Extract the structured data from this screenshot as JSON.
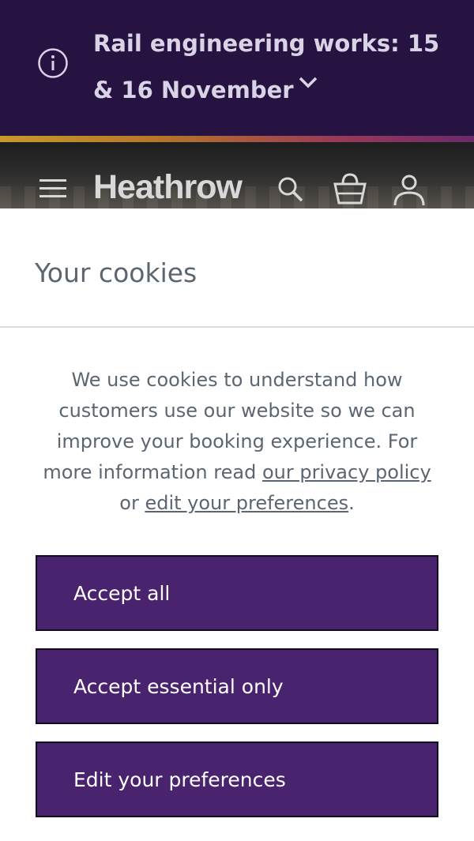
{
  "alert": {
    "text": "Rail engineering works: 15 & 16 November",
    "info_icon": "info-circle-icon",
    "expand_icon": "chevron-down-icon"
  },
  "header": {
    "logo_text": "Heathrow",
    "menu_icon": "hamburger-menu-icon",
    "search_icon": "search-icon",
    "basket_icon": "basket-icon",
    "account_icon": "account-icon"
  },
  "cookies": {
    "title": "Your cookies",
    "body_prefix": "We use cookies to understand how customers use our website so we can improve your booking experience. For more information read ",
    "privacy_link": "our privacy policy",
    "body_middle": " or ",
    "preferences_link": "edit your preferences",
    "body_suffix": ".",
    "buttons": {
      "accept_all": "Accept all",
      "accept_essential": "Accept essential only",
      "edit_preferences": "Edit your preferences"
    }
  },
  "colors": {
    "banner_bg": "#261342",
    "button_bg": "#4a236f",
    "text_grey": "#5c6670"
  }
}
